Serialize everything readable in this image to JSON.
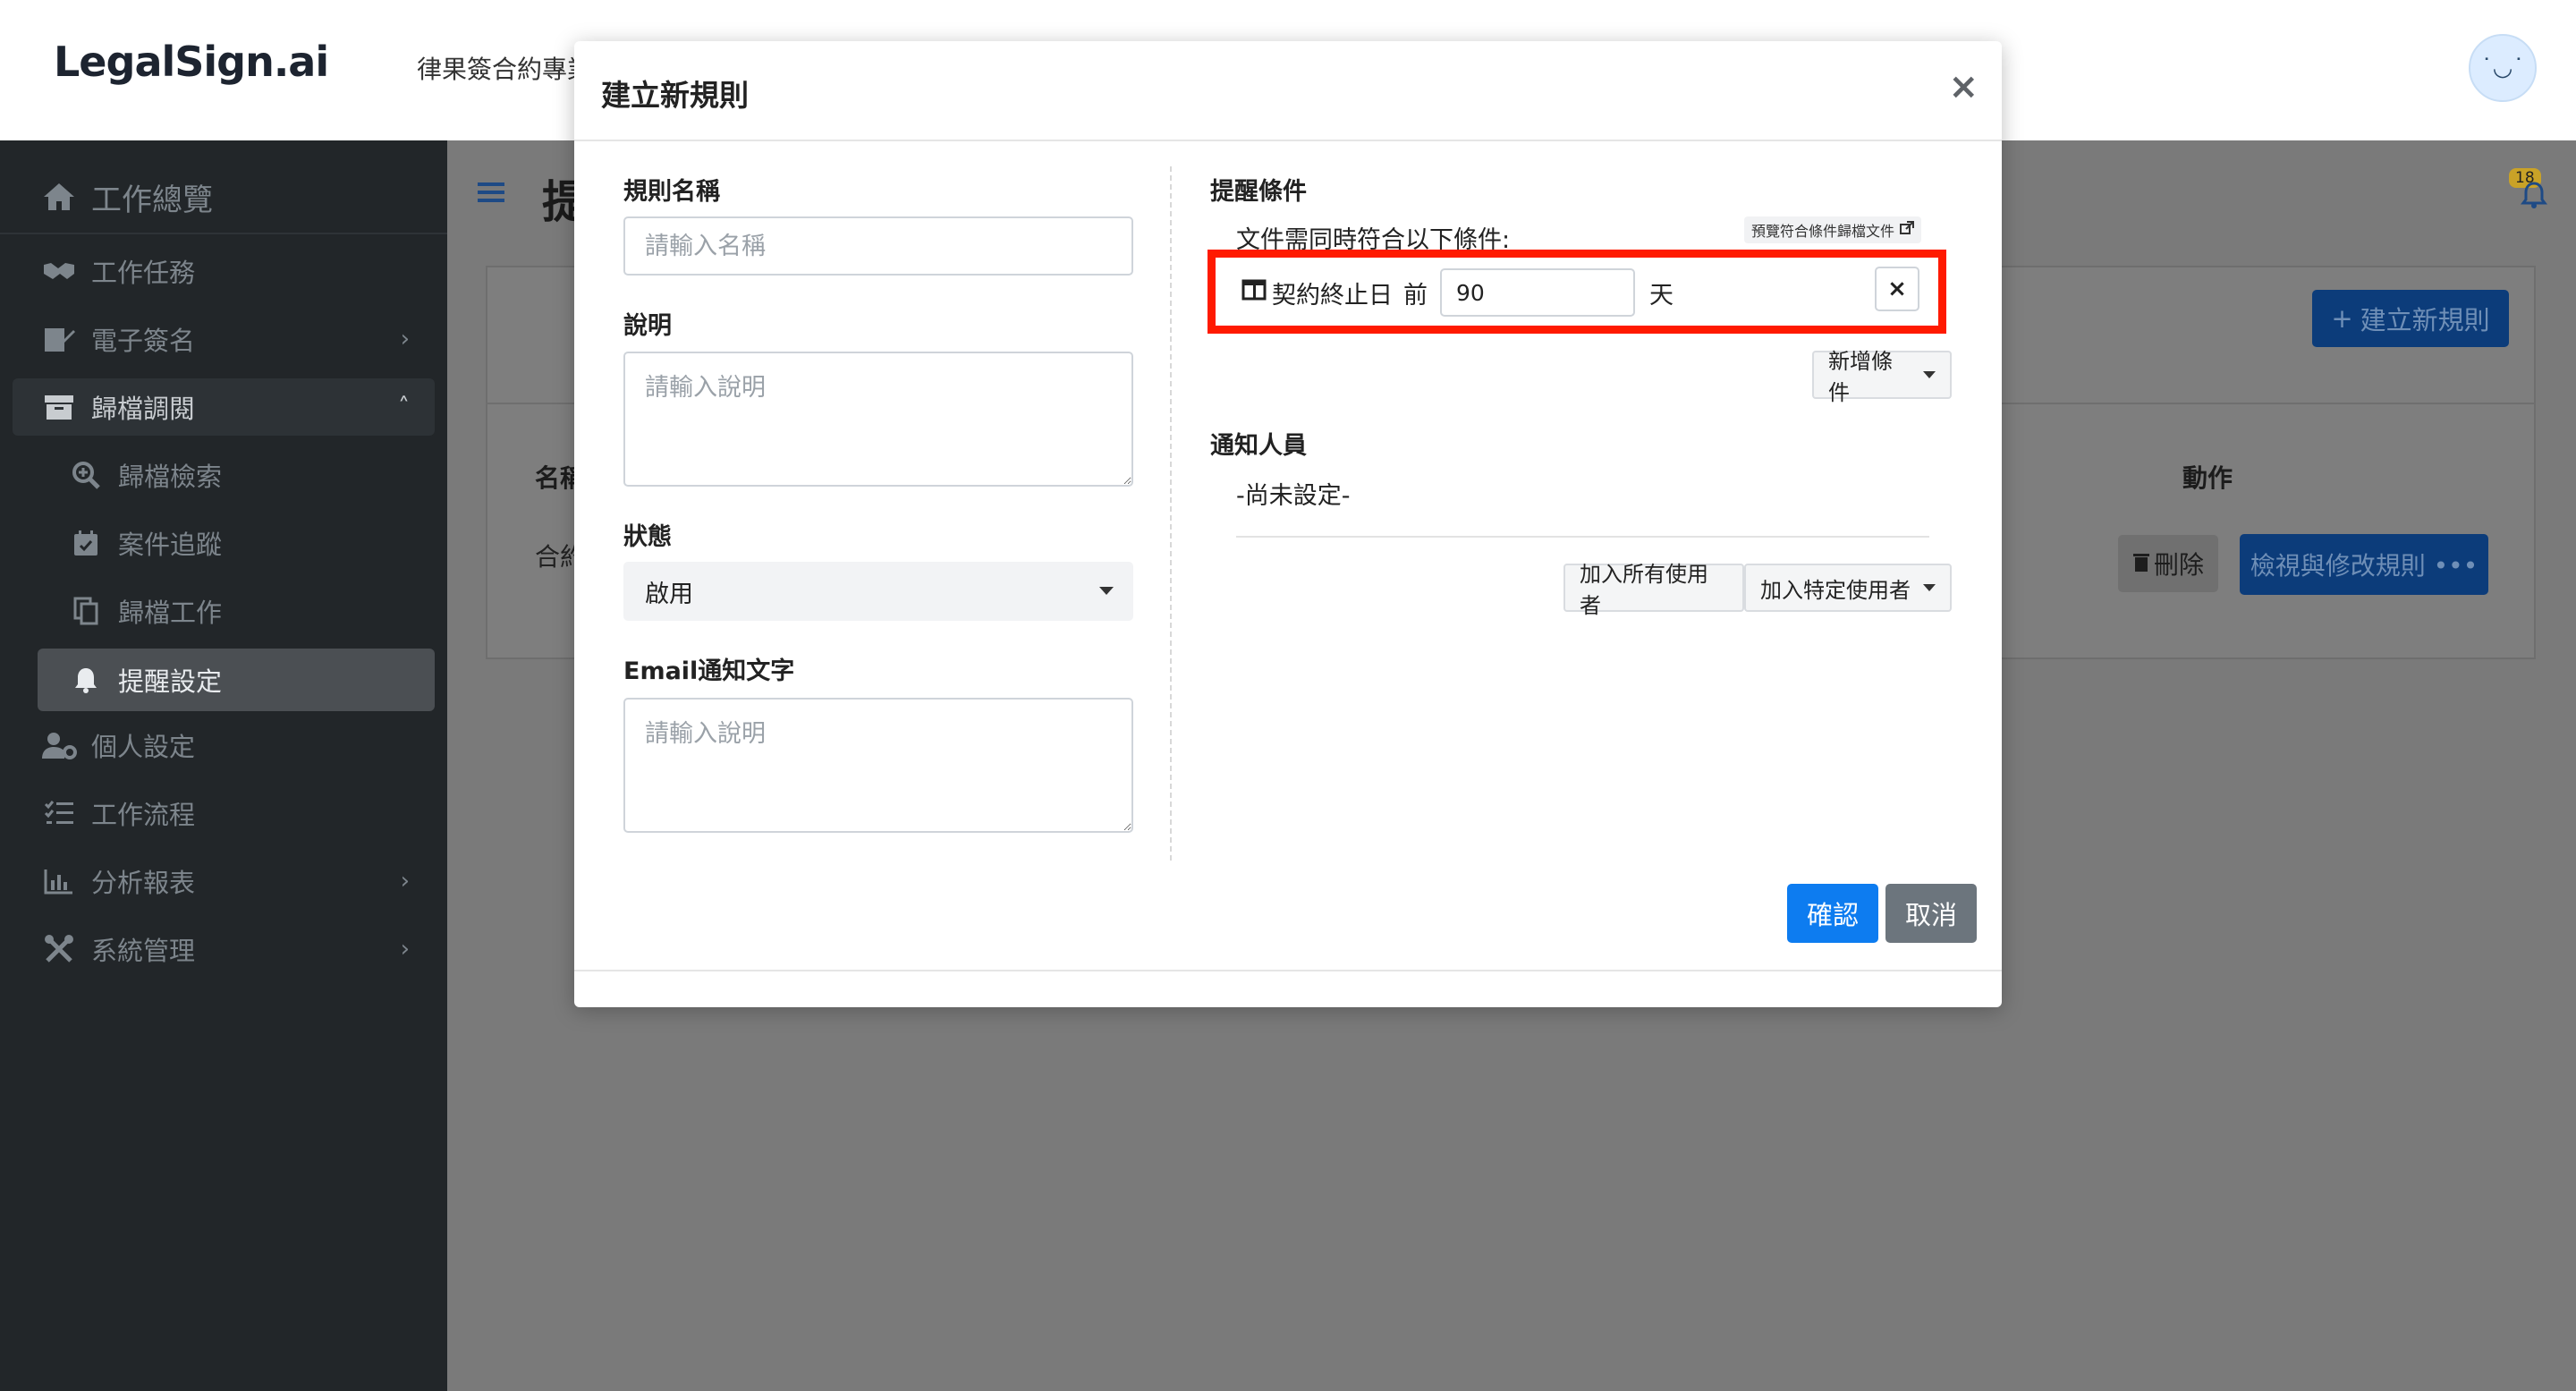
{
  "app": {
    "logo": "LegalSign.ai",
    "subtitle": "律果簽合約專業",
    "avatar": "˙◡˙"
  },
  "sidebar": {
    "items": [
      {
        "label": "工作總覽",
        "icon": "home-icon"
      },
      {
        "label": "工作任務",
        "icon": "handshake-icon"
      },
      {
        "label": "電子簽名",
        "icon": "signature-icon",
        "chevron": "›"
      },
      {
        "label": "歸檔調閱",
        "icon": "archive-icon",
        "chevron": "˄"
      },
      {
        "label": "歸檔檢索",
        "icon": "search-plus-icon"
      },
      {
        "label": "案件追蹤",
        "icon": "calendar-check-icon"
      },
      {
        "label": "歸檔工作",
        "icon": "copy-icon"
      },
      {
        "label": "提醒設定",
        "icon": "bell-icon"
      },
      {
        "label": "個人設定",
        "icon": "user-cog-icon"
      },
      {
        "label": "工作流程",
        "icon": "tasks-icon"
      },
      {
        "label": "分析報表",
        "icon": "chart-icon",
        "chevron": "›"
      },
      {
        "label": "系統管理",
        "icon": "tools-icon",
        "chevron": "›"
      }
    ]
  },
  "page": {
    "title": "提",
    "notification_count": "18",
    "create_rule_label": "建立新規則",
    "table": {
      "col_name": "名稱",
      "col_action": "動作",
      "row_name": "合約",
      "delete_label": "刪除",
      "view_edit_label": "檢視與修改規則 •••"
    }
  },
  "modal": {
    "title": "建立新規則",
    "close": "×",
    "rule_name_label": "規則名稱",
    "rule_name_placeholder": "請輸入名稱",
    "description_label": "說明",
    "description_placeholder": "請輸入說明",
    "status_label": "狀態",
    "status_value": "啟用",
    "email_label": "Email通知文字",
    "email_placeholder": "請輸入說明",
    "conditions_label": "提醒條件",
    "conditions_sub": "文件需同時符合以下條件:",
    "preview_link": "預覽符合條件歸檔文件",
    "condition": {
      "field": "契約終止日",
      "operator": "前",
      "value": "90",
      "unit": "天",
      "remove": "×"
    },
    "add_condition_label": "新增條件",
    "notify_label": "通知人員",
    "notify_empty": "-尚未設定-",
    "add_all_users_label": "加入所有使用者",
    "add_specific_user_label": "加入特定使用者",
    "confirm_label": "確認",
    "cancel_label": "取消"
  },
  "colors": {
    "primary": "#0d7cf0",
    "highlight": "#ff1a00",
    "sidebar": "#222629",
    "secondary": "#6c757d"
  }
}
